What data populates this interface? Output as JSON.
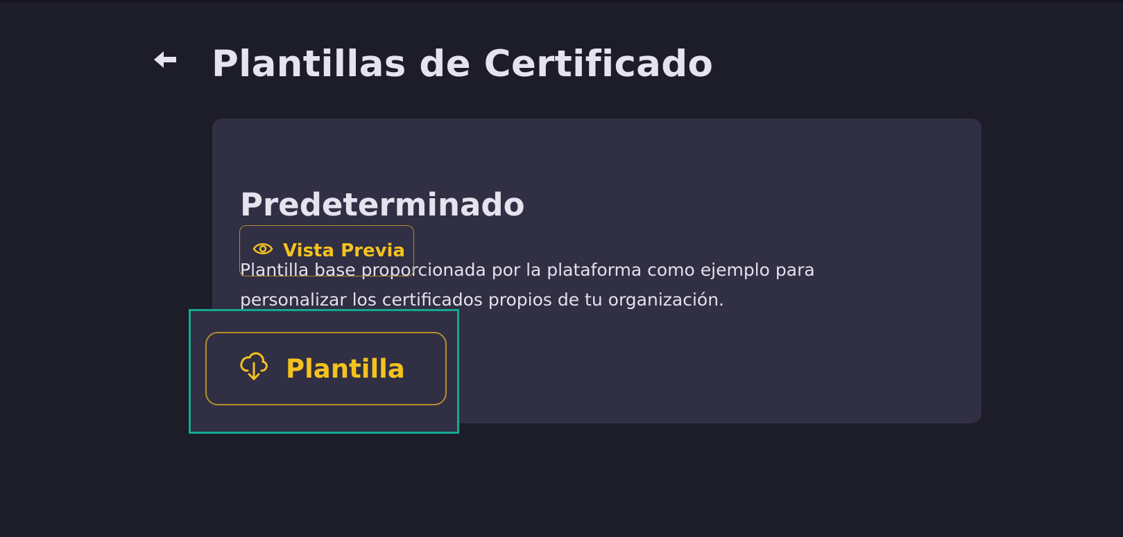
{
  "header": {
    "back_icon": "arrow-left-icon",
    "title": "Plantillas de Certificado"
  },
  "card": {
    "title": "Predeterminado",
    "description": "Plantilla base proporcionada por la plataforma como ejemplo para personalizar los certificados propios de tu organización.",
    "download_button": {
      "label": "Plantilla",
      "icon": "cloud-download-icon"
    },
    "preview_button": {
      "label": "Vista Previa",
      "icon": "eye-icon"
    }
  },
  "colors": {
    "background": "#1d1c29",
    "card": "#312f43",
    "text": "#e4e3ee",
    "accent": "#f4c21f",
    "accent_border": "#b48f2e",
    "highlight": "#14a98f"
  }
}
